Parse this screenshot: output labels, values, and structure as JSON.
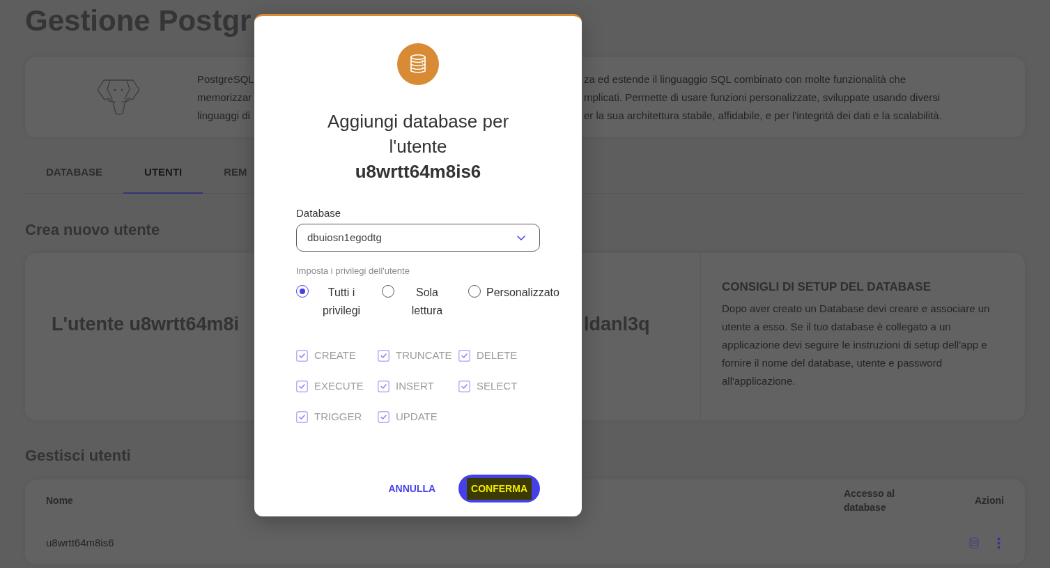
{
  "page_title": "Gestione Postgr",
  "intro": {
    "visible_text_left": [
      "PostgreSQL",
      "memorizzar",
      "linguaggi di"
    ],
    "visible_text_right": [
      "za ed estende il linguaggio SQL combinato con molte funzionalità che",
      "mplicati. Permette di usare funzioni personalizzate, sviluppate usando diversi",
      "er la sua architettura stabile, affidabile, e per l'integrità dei dati e la scalabilità."
    ]
  },
  "tabs": [
    {
      "label": "DATABASE",
      "selected": false
    },
    {
      "label": "UTENTI",
      "selected": true
    },
    {
      "label": "REM",
      "selected": false
    }
  ],
  "create_user": {
    "heading": "Crea nuovo utente",
    "message_visible_left": "L'utente u8wrtt64m8i",
    "message_visible_right": "ldanl3q",
    "tips": {
      "title": "CONSIGLI DI SETUP DEL DATABASE",
      "text": "Dopo aver creato un Database devi creare e associare un utente a esso. Se il tuo database è collegato a un applicazione devi seguire le instruzioni di setup dell'app e fornire il nome del database, utente e password all'applicazione."
    }
  },
  "manage_users": {
    "heading": "Gestisci utenti",
    "columns": [
      "Nome",
      "Accesso al database",
      "Azioni"
    ],
    "rows": [
      {
        "name": "u8wrtt64m8is6"
      }
    ]
  },
  "dialog": {
    "title": "Aggiungi database per l'utente **u8wrtt64m8is6**",
    "database_field": {
      "label": "Database",
      "value": "dbuiosn1egodtg"
    },
    "privileges_label": "Imposta i privilegi dell'utente",
    "privilege_modes": [
      {
        "label": "Tutti i privilegi",
        "selected": true
      },
      {
        "label": "Sola lettura",
        "selected": false
      },
      {
        "label": "Personalizzato",
        "selected": false
      }
    ],
    "privileges": [
      {
        "label": "CREATE",
        "checked": true,
        "disabled": true
      },
      {
        "label": "TRUNCATE",
        "checked": true,
        "disabled": true
      },
      {
        "label": "DELETE",
        "checked": true,
        "disabled": true
      },
      {
        "label": "EXECUTE",
        "checked": true,
        "disabled": true
      },
      {
        "label": "INSERT",
        "checked": true,
        "disabled": true
      },
      {
        "label": "SELECT",
        "checked": true,
        "disabled": true
      },
      {
        "label": "TRIGGER",
        "checked": true,
        "disabled": true
      },
      {
        "label": "UPDATE",
        "checked": true,
        "disabled": true
      }
    ],
    "buttons": [
      {
        "label": "ANNULLA",
        "kind": "text"
      },
      {
        "label": "CONFERMA",
        "kind": "primary",
        "highlighted": true
      }
    ]
  }
}
